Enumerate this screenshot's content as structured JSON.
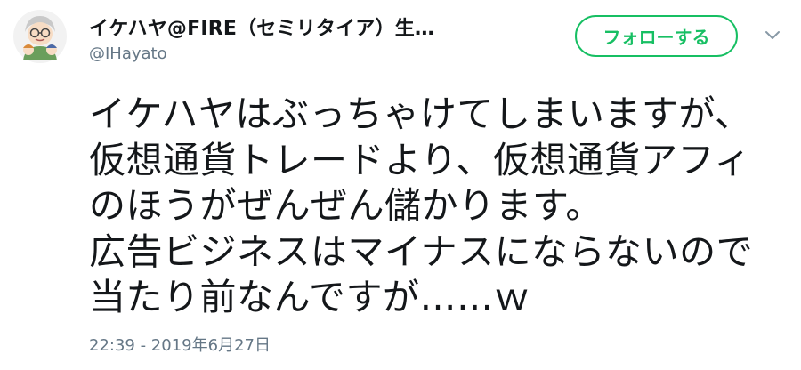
{
  "tweet": {
    "display_name": "イケハヤ@FIRE（セミリタイア）生…",
    "handle": "@IHayato",
    "follow_label": "フォローする",
    "lines": [
      "イケハヤはぶっちゃけてしまいますが、",
      "仮想通貨トレードより、仮想通貨アフィ",
      "のほうがぜんぜん儲かります。",
      "広告ビジネスはマイナスにならないので",
      "当たり前なんですが……ｗ"
    ],
    "timestamp": "22:39 - 2019年6月27日"
  },
  "icons": {
    "avatar": "avatar-illustration",
    "menu": "chevron-down-icon"
  },
  "colors": {
    "follow_green": "#17bf63",
    "secondary_text": "#657786"
  }
}
